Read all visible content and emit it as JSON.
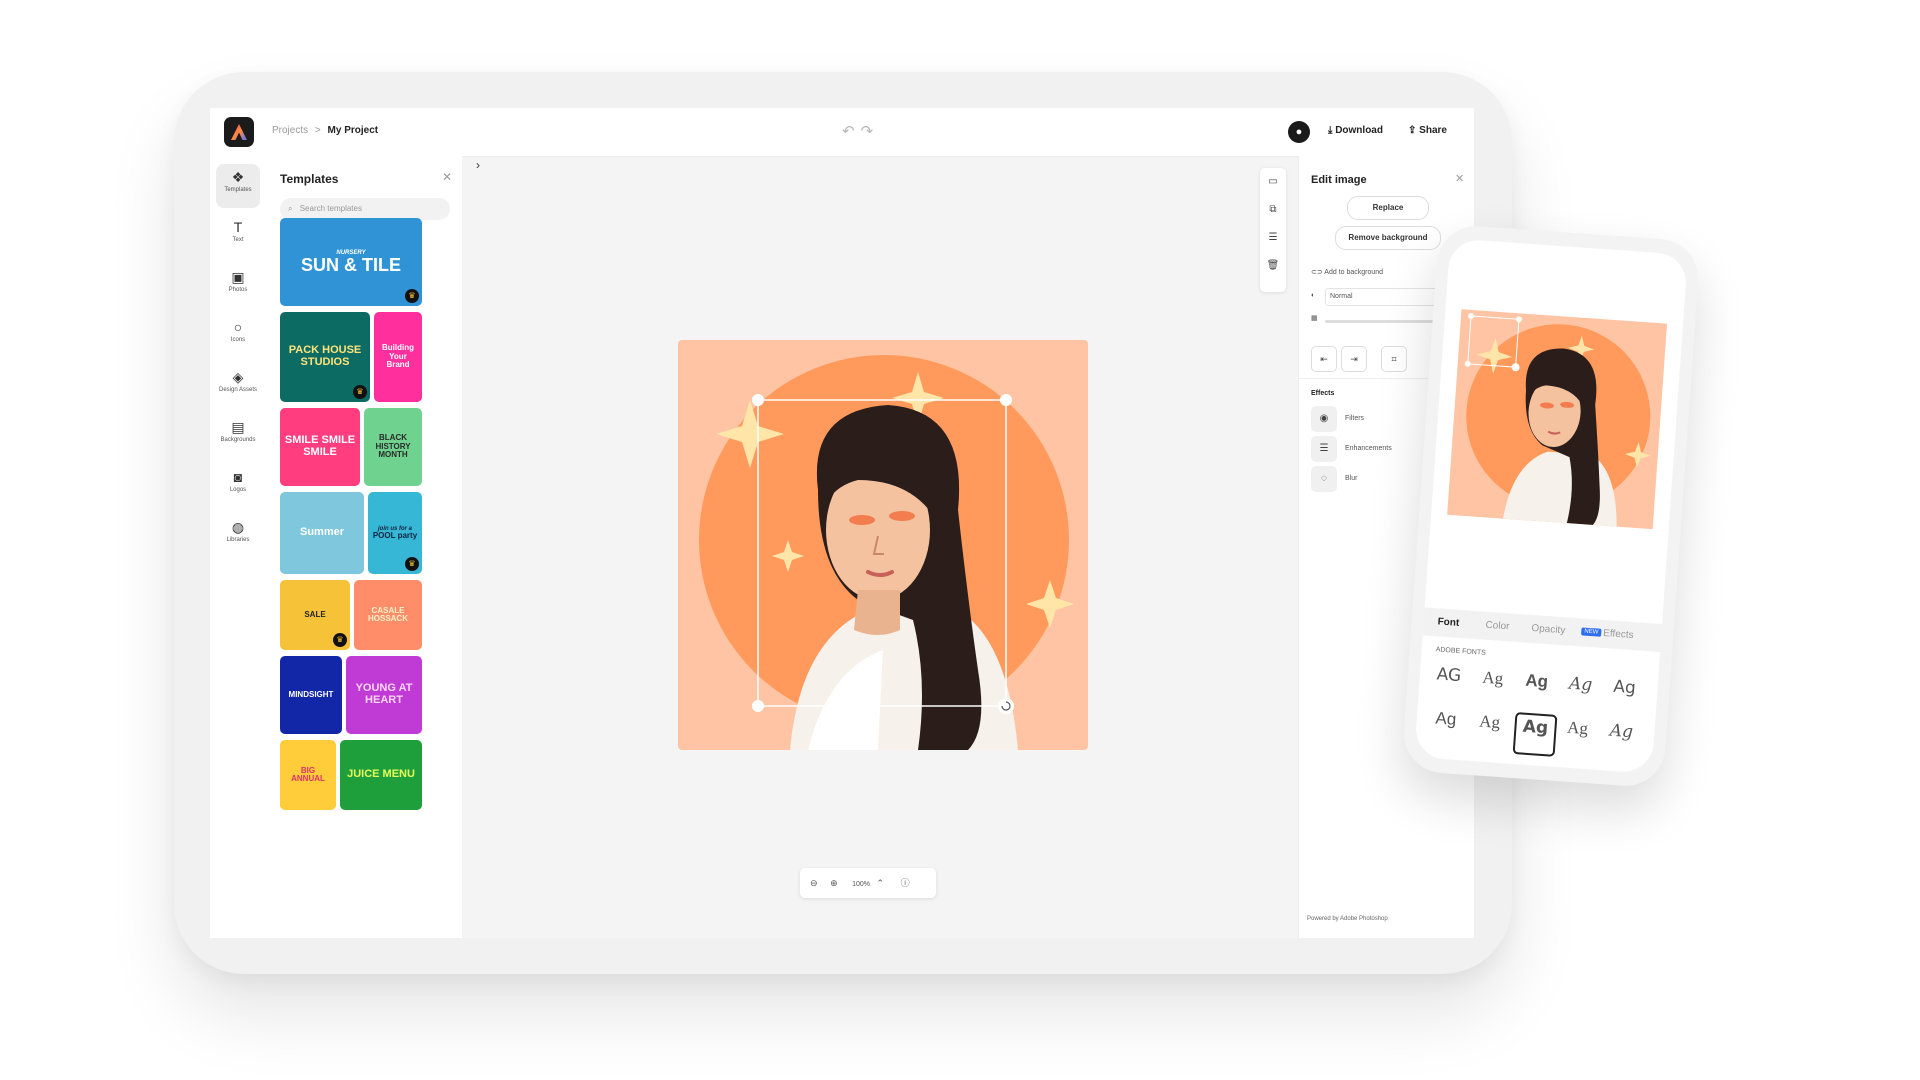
{
  "topbar": {
    "breadcrumb_parent": "Projects",
    "breadcrumb_separator": ">",
    "breadcrumb_current": "My Project",
    "download_label": "Download",
    "share_label": "Share"
  },
  "rail": {
    "items": [
      {
        "label": "Templates",
        "icon": "templates-icon",
        "glyph": "❖",
        "active": true
      },
      {
        "label": "Text",
        "icon": "text-icon",
        "glyph": "T"
      },
      {
        "label": "Photos",
        "icon": "photos-icon",
        "glyph": "▣"
      },
      {
        "label": "Icons",
        "icon": "icons-icon",
        "glyph": "○"
      },
      {
        "label": "Design Assets",
        "icon": "design-assets-icon",
        "glyph": "◈"
      },
      {
        "label": "Backgrounds",
        "icon": "backgrounds-icon",
        "glyph": "▤"
      },
      {
        "label": "Logos",
        "icon": "logos-icon",
        "glyph": "◙"
      },
      {
        "label": "Libraries",
        "icon": "libraries-icon",
        "glyph": "◍"
      }
    ]
  },
  "templates_panel": {
    "title": "Templates",
    "search_placeholder": "Search templates",
    "thumbs": [
      {
        "title": "SUN & TILE",
        "subtitle": "NURSERY",
        "bg": "#2f93d6",
        "fg": "#ffffff"
      },
      {
        "title": "PACK HOUSE STUDIOS",
        "subtitle": "",
        "bg": "#0c6b62",
        "fg": "#ffe37a"
      },
      {
        "title": "Building Your Brand",
        "subtitle": "",
        "bg": "#ff2f9e",
        "fg": "#ffffff"
      },
      {
        "title": "SMILE SMILE SMILE",
        "subtitle": "",
        "bg": "#ff3d7f",
        "fg": "#ffffff"
      },
      {
        "title": "BLACK HISTORY MONTH",
        "subtitle": "",
        "bg": "#6fd28f",
        "fg": "#2a2a2a"
      },
      {
        "title": "Summer",
        "subtitle": "",
        "bg": "#7fc7dc",
        "fg": "#ffffff"
      },
      {
        "title": "POOL party",
        "subtitle": "join us for a",
        "bg": "#37b7d6",
        "fg": "#11233d"
      },
      {
        "title": "SALE",
        "subtitle": "",
        "bg": "#f6c338",
        "fg": "#222222"
      },
      {
        "title": "CASALE HOSSACK",
        "subtitle": "",
        "bg": "#ff8d6a",
        "fg": "#fff0c8"
      },
      {
        "title": "MINDSIGHT",
        "subtitle": "",
        "bg": "#1226a8",
        "fg": "#ffffff"
      },
      {
        "title": "YOUNG AT HEART",
        "subtitle": "",
        "bg": "#c03bd6",
        "fg": "#ffd6f5"
      },
      {
        "title": "BIG ANNUAL",
        "subtitle": "",
        "bg": "#ffcc3a",
        "fg": "#e0306a"
      },
      {
        "title": "JUICE MENU",
        "subtitle": "",
        "bg": "#1e9f3c",
        "fg": "#e6ff5a"
      }
    ]
  },
  "zoom": {
    "level": "100%"
  },
  "edit_panel": {
    "title": "Edit image",
    "replace_label": "Replace",
    "remove_bg_label": "Remove background",
    "add_to_bg_label": "Add to background",
    "blend_mode": "Normal",
    "effects_title": "Effects",
    "effects": [
      "Filters",
      "Enhancements",
      "Blur"
    ],
    "powered_by": "Powered by Adobe Photoshop"
  },
  "phone": {
    "tabs": [
      "Font",
      "Color",
      "Opacity",
      "Effects"
    ],
    "new_badge": "NEW",
    "fonts_label": "ADOBE FONTS",
    "fonts": [
      "AG",
      "Ag",
      "Ag",
      "Ag",
      "Ag",
      "Ag",
      "Ag",
      "Ag",
      "Ag",
      "Ag"
    ]
  },
  "colors": {
    "canvas_bg": "#ffc4a4",
    "circle": "#ff9a5c",
    "accent_blue": "#2f6cf0"
  }
}
